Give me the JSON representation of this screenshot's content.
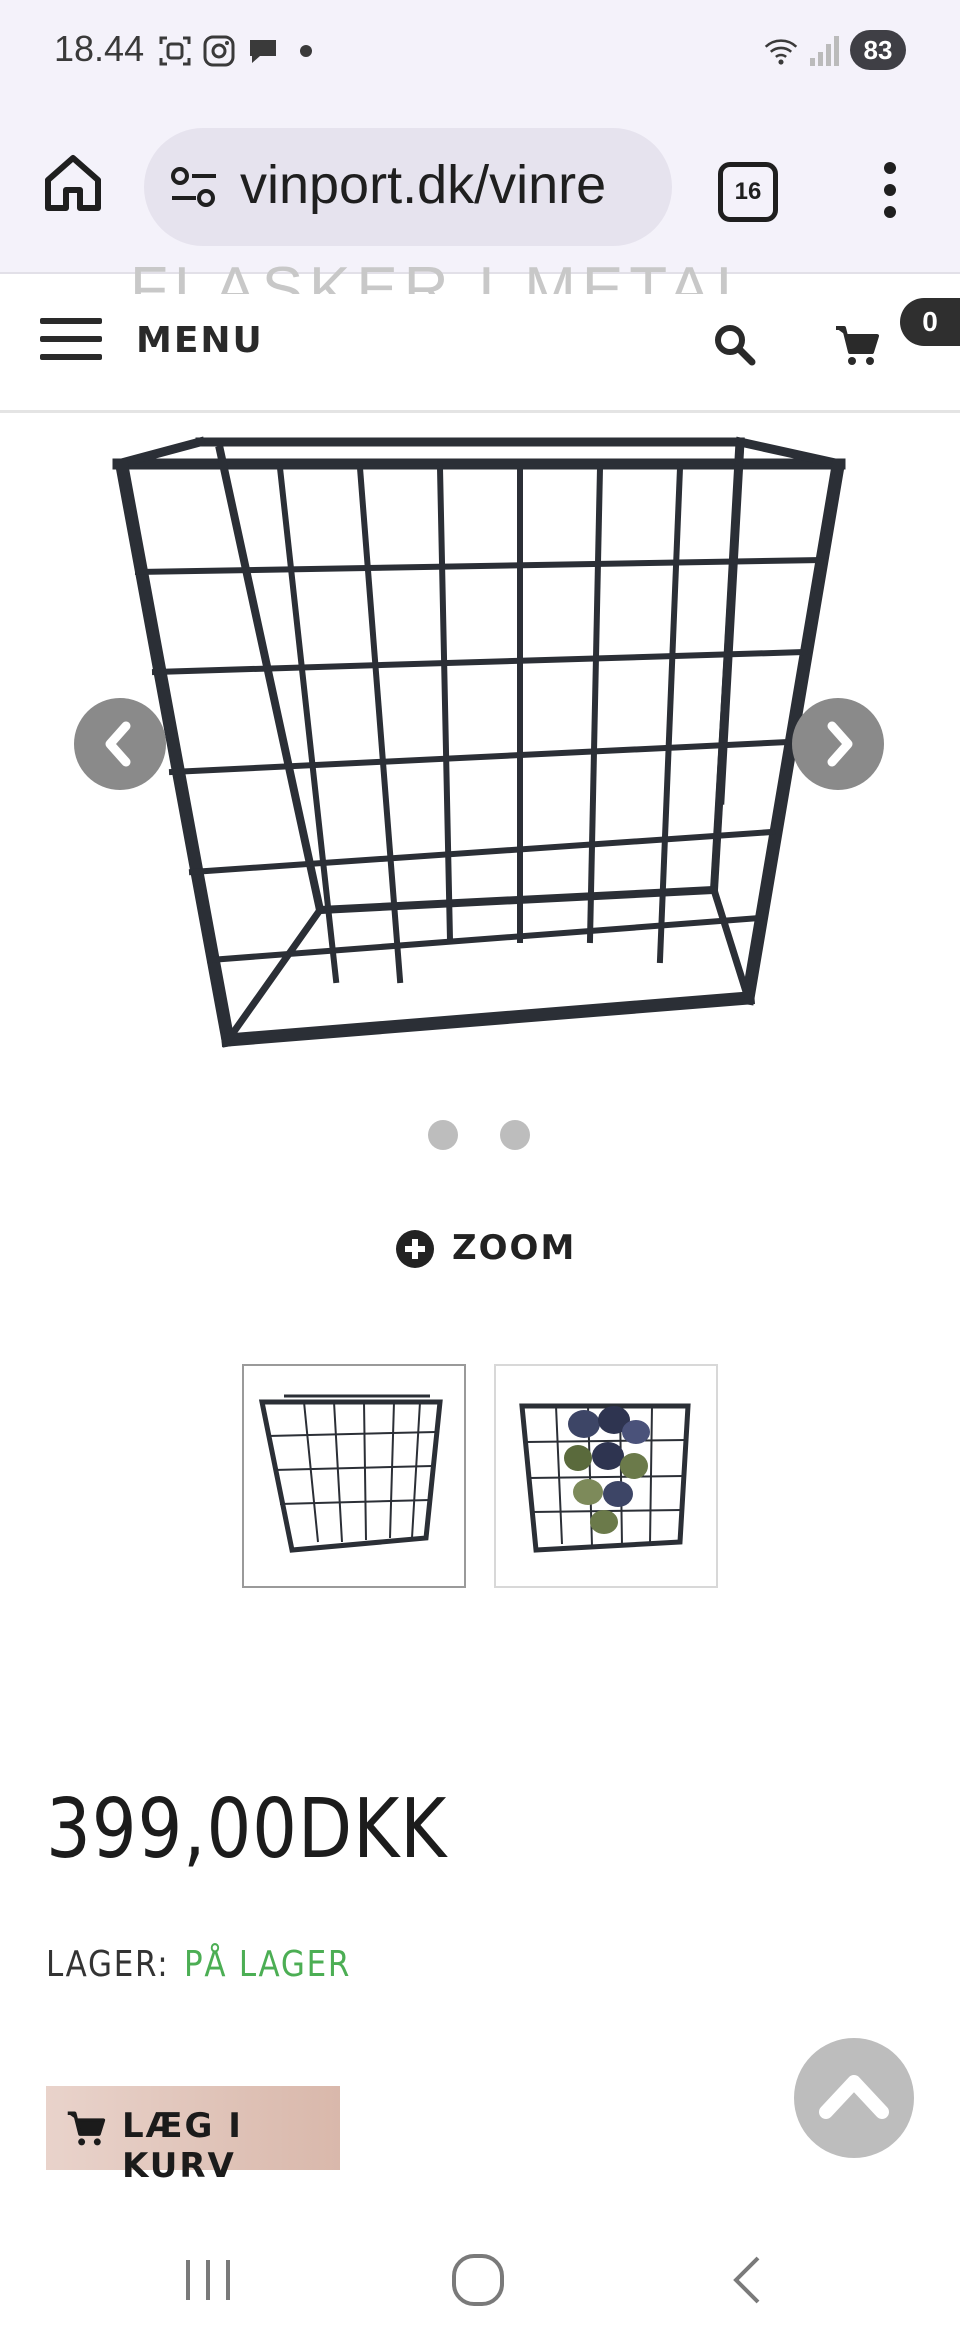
{
  "status_bar": {
    "time": "18.44",
    "battery": "83",
    "icons": [
      "screenshot-icon",
      "instagram-icon",
      "chat-icon",
      "dot-icon",
      "wifi-icon",
      "signal-icon"
    ]
  },
  "browser": {
    "url": "vinport.dk/vinre",
    "tab_count": "16",
    "icons": [
      "home-icon",
      "site-settings-icon",
      "tabs-icon",
      "more-vert-icon"
    ]
  },
  "site_header": {
    "ghost_title": "FLASKER I METAL",
    "menu_label": "MENU",
    "cart_count": "0",
    "icons": [
      "hamburger-icon",
      "search-icon",
      "cart-icon"
    ]
  },
  "gallery": {
    "zoom_label": "ZOOM",
    "dots": 2,
    "thumbnails": [
      "wine-rack-empty",
      "wine-rack-with-bottles"
    ],
    "icons": [
      "chevron-left-icon",
      "chevron-right-icon",
      "plus-circle-icon"
    ]
  },
  "product": {
    "price": "399,00DKK",
    "stock_label": "LAGER:",
    "stock_value": "PÅ LAGER",
    "add_to_cart_label": "LÆG I KURV",
    "colors": {
      "in_stock": "#4cae54",
      "button": "#e2c6bb"
    }
  },
  "system_nav": {
    "icons": [
      "recents-icon",
      "home-circle-icon",
      "back-icon"
    ]
  }
}
